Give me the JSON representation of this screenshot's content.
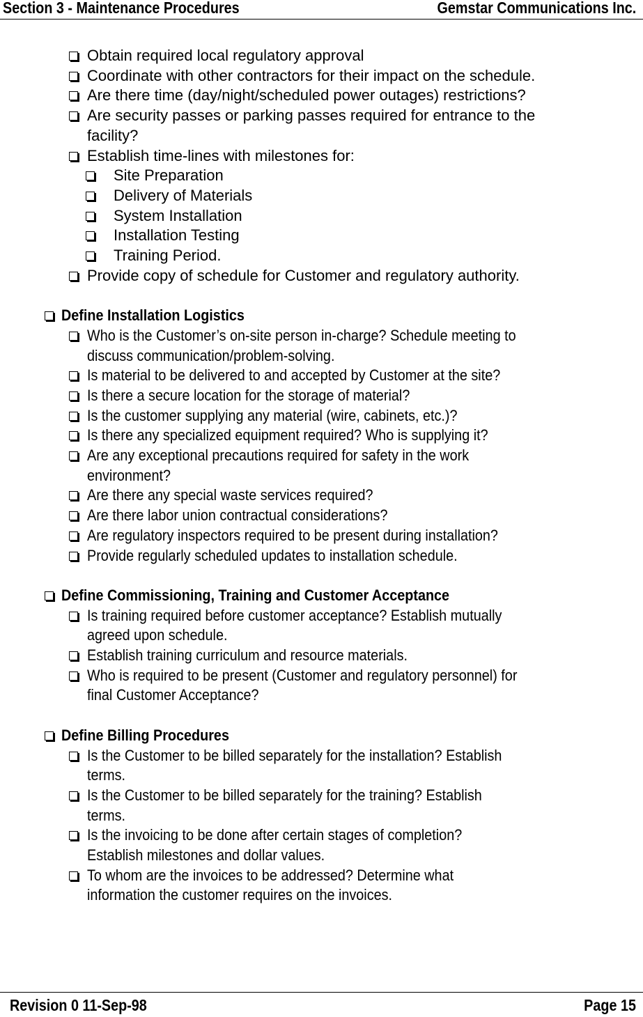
{
  "header": {
    "section": "Section 3 - Maintenance Procedures",
    "company": "Gemstar Communications Inc."
  },
  "intro_items": [
    {
      "text": "Obtain required local regulatory approval"
    },
    {
      "text": "Coordinate with other contractors for their impact on the schedule."
    },
    {
      "text": "Are there time (day/night/scheduled power outages) restrictions?"
    },
    {
      "text": "Are security passes or parking passes required for entrance to the",
      "cont": "facility?"
    },
    {
      "text": "Establish time-lines with milestones for:"
    }
  ],
  "milestones": [
    "Site Preparation",
    "Delivery of Materials",
    "System Installation",
    "Installation Testing",
    "Training Period."
  ],
  "intro_final": "Provide copy of schedule for Customer and regulatory authority.",
  "sections": [
    {
      "heading": "Define Installation Logistics",
      "items": [
        {
          "text": "Who is the Customer’s on-site person in-charge?  Schedule meeting to",
          "cont": "discuss communication/problem-solving."
        },
        {
          "text": "Is material to be delivered to and accepted by Customer at the site?"
        },
        {
          "text": "Is there a secure location for the storage of material?"
        },
        {
          "text": "Is the customer supplying any material (wire, cabinets, etc.)?"
        },
        {
          "text": "Is there any specialized equipment required?  Who is supplying it?"
        },
        {
          "text": "Are any exceptional precautions required for safety in the work",
          "cont": "environment?"
        },
        {
          "text": "Are there any special waste services required?"
        },
        {
          "text": "Are there labor union contractual considerations?"
        },
        {
          "text": "Are regulatory inspectors required to be present during installation?"
        },
        {
          "text": "Provide regularly scheduled updates to installation schedule."
        }
      ]
    },
    {
      "heading": "Define Commissioning, Training and Customer Acceptance",
      "items": [
        {
          "text": "Is training required before customer acceptance?  Establish mutually",
          "cont": "agreed upon schedule."
        },
        {
          "text": "Establish training curriculum and resource materials."
        },
        {
          "text": "Who is required to be present (Customer and regulatory personnel) for",
          "cont": "final Customer Acceptance?"
        }
      ]
    },
    {
      "heading": "Define Billing Procedures",
      "items": [
        {
          "text": "Is the Customer to be billed separately for the installation?  Establish",
          "cont": "terms."
        },
        {
          "text": "Is the Customer to be billed separately for the training?  Establish",
          "cont": "terms."
        },
        {
          "text": "Is the invoicing to be done after certain stages of completion?",
          "cont": "Establish milestones and dollar values."
        },
        {
          "text": "To whom are the invoices to be addressed?  Determine what",
          "cont": "information the customer requires on the invoices."
        }
      ]
    }
  ],
  "footer": {
    "revision": "Revision 0  11-Sep-98",
    "page": "Page 15"
  }
}
